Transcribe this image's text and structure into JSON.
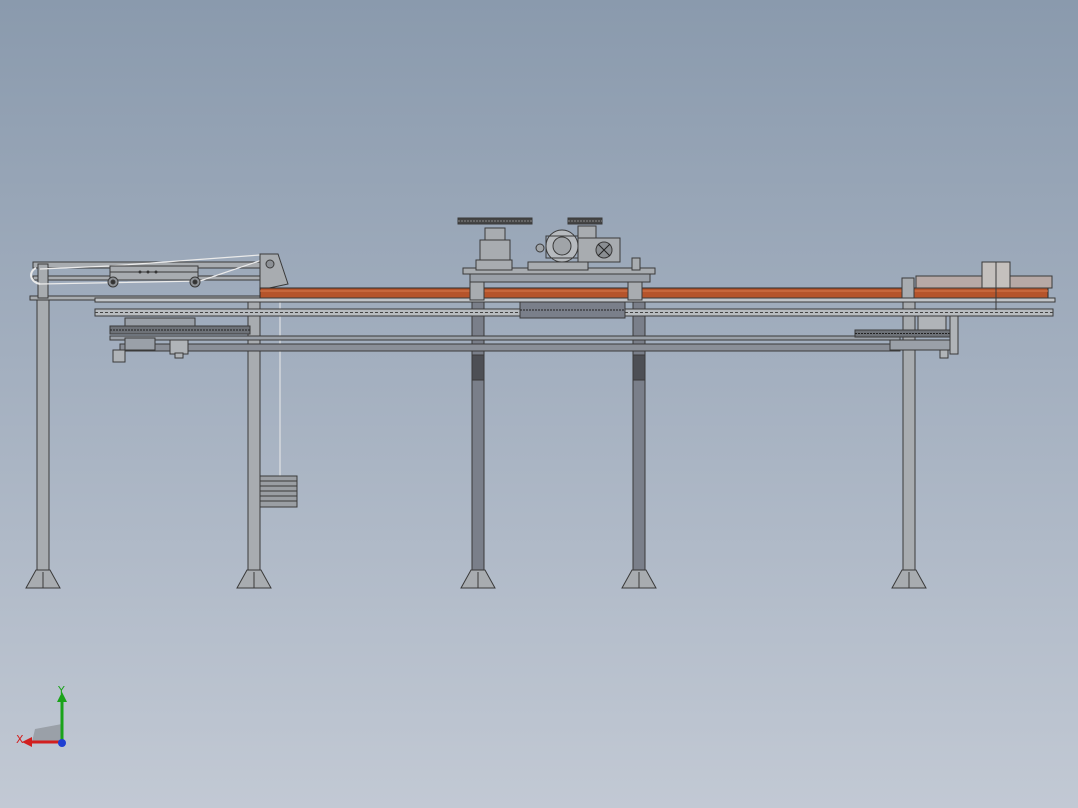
{
  "viewport": {
    "background_top": "#8a9aad",
    "background_bottom": "#c2c9d4"
  },
  "model": {
    "frame_color": "#a8acb0",
    "outline_color": "#3a3a3a",
    "conveyor_color": "#b5542b",
    "dark_leg_color": "#6a6f7a"
  },
  "triad": {
    "x_label": "X",
    "y_label": "Y",
    "x_color": "#d21f1f",
    "y_color": "#1aa31a",
    "z_color": "#1f3fd2"
  }
}
